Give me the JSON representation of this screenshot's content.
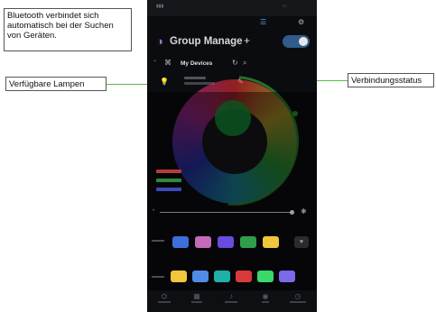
{
  "callouts": {
    "bluetooth": "Bluetooth verbindet sich automatisch bei der Suchen von Geräten.",
    "lamps": "Verfügbare Lampen",
    "status": "Verbindungsstatus"
  },
  "header": {
    "title": "Group Manage",
    "add_symbol": "+"
  },
  "devices": {
    "label": "My Devices"
  },
  "colors": {
    "accent": "#2f5c88",
    "ring": "#2f8a2f",
    "leader": "#5cba4a"
  },
  "swatch_row_1": [
    "#3e6ed8",
    "#c46ab6",
    "#6a4be0",
    "#2f9e4c",
    "#f0c63a"
  ],
  "swatch_row_2": [
    "#f0c63a",
    "#4e8ce6",
    "#1fb0a8",
    "#d83a3a",
    "#3ad86a",
    "#7a6ae8"
  ],
  "nav": {
    "items": [
      {
        "icon": "group-icon",
        "glyph": "⛭"
      },
      {
        "icon": "grid-icon",
        "glyph": "▦"
      },
      {
        "icon": "music-icon",
        "glyph": "♪"
      },
      {
        "icon": "mic-icon",
        "glyph": "◉"
      },
      {
        "icon": "timer-icon",
        "glyph": "◷"
      }
    ]
  }
}
